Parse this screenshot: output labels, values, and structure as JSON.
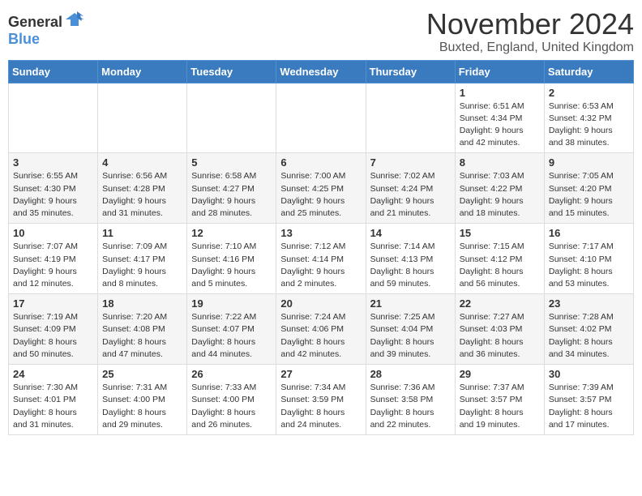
{
  "header": {
    "logo_general": "General",
    "logo_blue": "Blue",
    "month_title": "November 2024",
    "location": "Buxted, England, United Kingdom"
  },
  "columns": [
    "Sunday",
    "Monday",
    "Tuesday",
    "Wednesday",
    "Thursday",
    "Friday",
    "Saturday"
  ],
  "weeks": [
    [
      {
        "day": "",
        "info": ""
      },
      {
        "day": "",
        "info": ""
      },
      {
        "day": "",
        "info": ""
      },
      {
        "day": "",
        "info": ""
      },
      {
        "day": "",
        "info": ""
      },
      {
        "day": "1",
        "info": "Sunrise: 6:51 AM\nSunset: 4:34 PM\nDaylight: 9 hours and 42 minutes."
      },
      {
        "day": "2",
        "info": "Sunrise: 6:53 AM\nSunset: 4:32 PM\nDaylight: 9 hours and 38 minutes."
      }
    ],
    [
      {
        "day": "3",
        "info": "Sunrise: 6:55 AM\nSunset: 4:30 PM\nDaylight: 9 hours and 35 minutes."
      },
      {
        "day": "4",
        "info": "Sunrise: 6:56 AM\nSunset: 4:28 PM\nDaylight: 9 hours and 31 minutes."
      },
      {
        "day": "5",
        "info": "Sunrise: 6:58 AM\nSunset: 4:27 PM\nDaylight: 9 hours and 28 minutes."
      },
      {
        "day": "6",
        "info": "Sunrise: 7:00 AM\nSunset: 4:25 PM\nDaylight: 9 hours and 25 minutes."
      },
      {
        "day": "7",
        "info": "Sunrise: 7:02 AM\nSunset: 4:24 PM\nDaylight: 9 hours and 21 minutes."
      },
      {
        "day": "8",
        "info": "Sunrise: 7:03 AM\nSunset: 4:22 PM\nDaylight: 9 hours and 18 minutes."
      },
      {
        "day": "9",
        "info": "Sunrise: 7:05 AM\nSunset: 4:20 PM\nDaylight: 9 hours and 15 minutes."
      }
    ],
    [
      {
        "day": "10",
        "info": "Sunrise: 7:07 AM\nSunset: 4:19 PM\nDaylight: 9 hours and 12 minutes."
      },
      {
        "day": "11",
        "info": "Sunrise: 7:09 AM\nSunset: 4:17 PM\nDaylight: 9 hours and 8 minutes."
      },
      {
        "day": "12",
        "info": "Sunrise: 7:10 AM\nSunset: 4:16 PM\nDaylight: 9 hours and 5 minutes."
      },
      {
        "day": "13",
        "info": "Sunrise: 7:12 AM\nSunset: 4:14 PM\nDaylight: 9 hours and 2 minutes."
      },
      {
        "day": "14",
        "info": "Sunrise: 7:14 AM\nSunset: 4:13 PM\nDaylight: 8 hours and 59 minutes."
      },
      {
        "day": "15",
        "info": "Sunrise: 7:15 AM\nSunset: 4:12 PM\nDaylight: 8 hours and 56 minutes."
      },
      {
        "day": "16",
        "info": "Sunrise: 7:17 AM\nSunset: 4:10 PM\nDaylight: 8 hours and 53 minutes."
      }
    ],
    [
      {
        "day": "17",
        "info": "Sunrise: 7:19 AM\nSunset: 4:09 PM\nDaylight: 8 hours and 50 minutes."
      },
      {
        "day": "18",
        "info": "Sunrise: 7:20 AM\nSunset: 4:08 PM\nDaylight: 8 hours and 47 minutes."
      },
      {
        "day": "19",
        "info": "Sunrise: 7:22 AM\nSunset: 4:07 PM\nDaylight: 8 hours and 44 minutes."
      },
      {
        "day": "20",
        "info": "Sunrise: 7:24 AM\nSunset: 4:06 PM\nDaylight: 8 hours and 42 minutes."
      },
      {
        "day": "21",
        "info": "Sunrise: 7:25 AM\nSunset: 4:04 PM\nDaylight: 8 hours and 39 minutes."
      },
      {
        "day": "22",
        "info": "Sunrise: 7:27 AM\nSunset: 4:03 PM\nDaylight: 8 hours and 36 minutes."
      },
      {
        "day": "23",
        "info": "Sunrise: 7:28 AM\nSunset: 4:02 PM\nDaylight: 8 hours and 34 minutes."
      }
    ],
    [
      {
        "day": "24",
        "info": "Sunrise: 7:30 AM\nSunset: 4:01 PM\nDaylight: 8 hours and 31 minutes."
      },
      {
        "day": "25",
        "info": "Sunrise: 7:31 AM\nSunset: 4:00 PM\nDaylight: 8 hours and 29 minutes."
      },
      {
        "day": "26",
        "info": "Sunrise: 7:33 AM\nSunset: 4:00 PM\nDaylight: 8 hours and 26 minutes."
      },
      {
        "day": "27",
        "info": "Sunrise: 7:34 AM\nSunset: 3:59 PM\nDaylight: 8 hours and 24 minutes."
      },
      {
        "day": "28",
        "info": "Sunrise: 7:36 AM\nSunset: 3:58 PM\nDaylight: 8 hours and 22 minutes."
      },
      {
        "day": "29",
        "info": "Sunrise: 7:37 AM\nSunset: 3:57 PM\nDaylight: 8 hours and 19 minutes."
      },
      {
        "day": "30",
        "info": "Sunrise: 7:39 AM\nSunset: 3:57 PM\nDaylight: 8 hours and 17 minutes."
      }
    ]
  ]
}
